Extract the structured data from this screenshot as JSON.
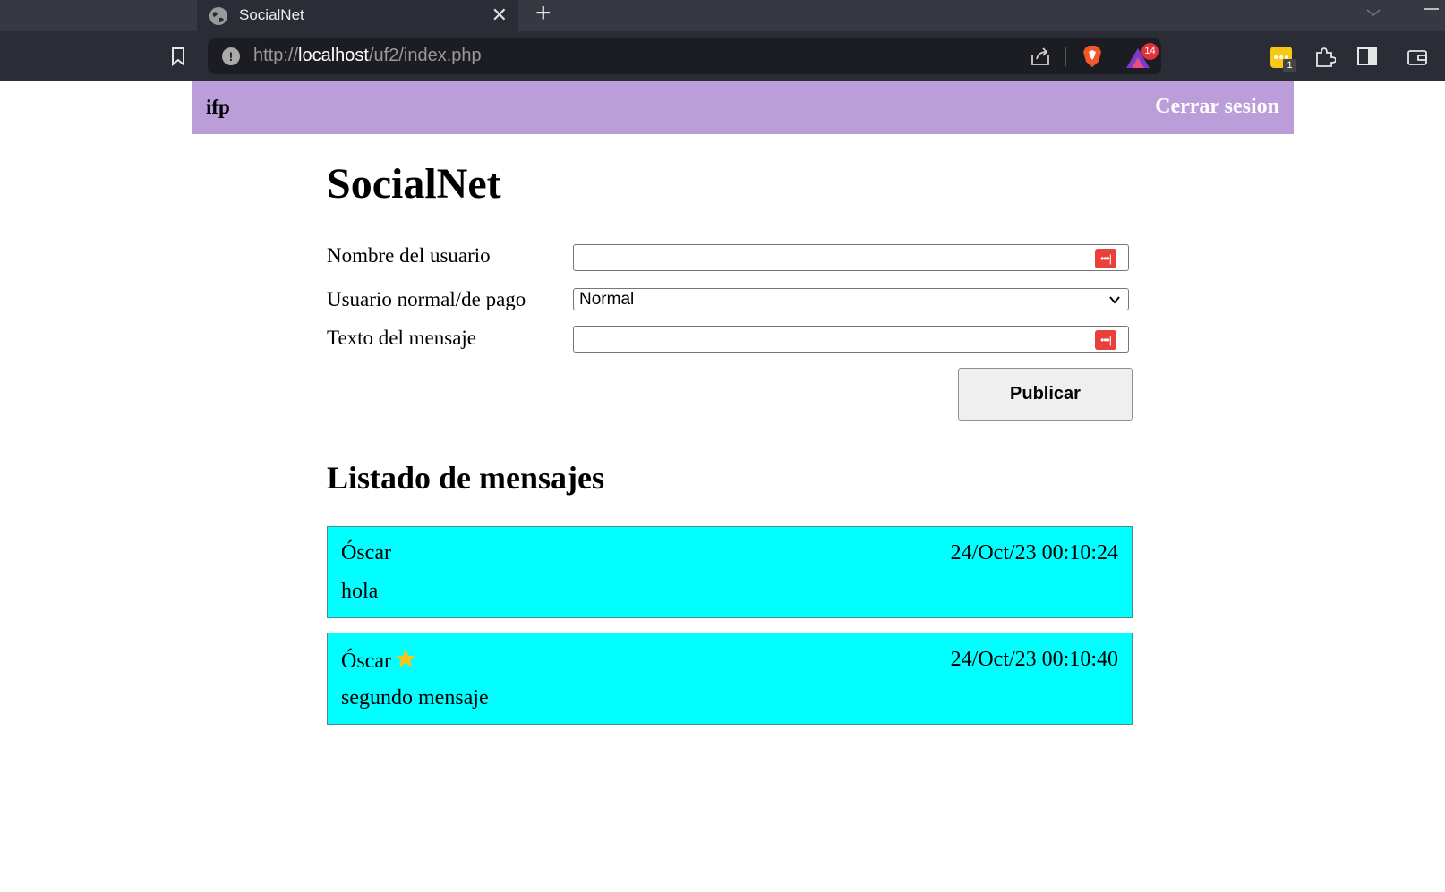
{
  "browser": {
    "tab_title": "SocialNet",
    "url_scheme": "http://",
    "url_host": "localhost",
    "url_path": "/uf2/index.php",
    "rewards_count": "14",
    "extension_badge": "1",
    "icons": [
      "globe-icon",
      "close-icon",
      "plus-icon",
      "bookmark-icon",
      "info-icon",
      "share-icon",
      "brave-shield-icon",
      "rewards-icon",
      "password-manager-icon",
      "puzzle-icon",
      "sidebar-icon",
      "wallet-icon"
    ]
  },
  "navbar": {
    "brand": "ifp",
    "logout": "Cerrar sesion",
    "color": "#bb9dd9"
  },
  "page": {
    "title": "SocialNet"
  },
  "form": {
    "username_label": "Nombre del usuario",
    "username_value": "",
    "type_label": "Usuario normal/de pago",
    "type_selected": "Normal",
    "message_label": "Texto del mensaje",
    "message_value": "",
    "submit_label": "Publicar"
  },
  "messages_section": {
    "title": "Listado de mensajes",
    "card_color": "#00ffff",
    "items": [
      {
        "author": "Óscar",
        "premium": false,
        "date": "24/Oct/23 00:10:24",
        "text": "hola"
      },
      {
        "author": "Óscar",
        "premium": true,
        "date": "24/Oct/23 00:10:40",
        "text": "segundo mensaje"
      }
    ]
  }
}
